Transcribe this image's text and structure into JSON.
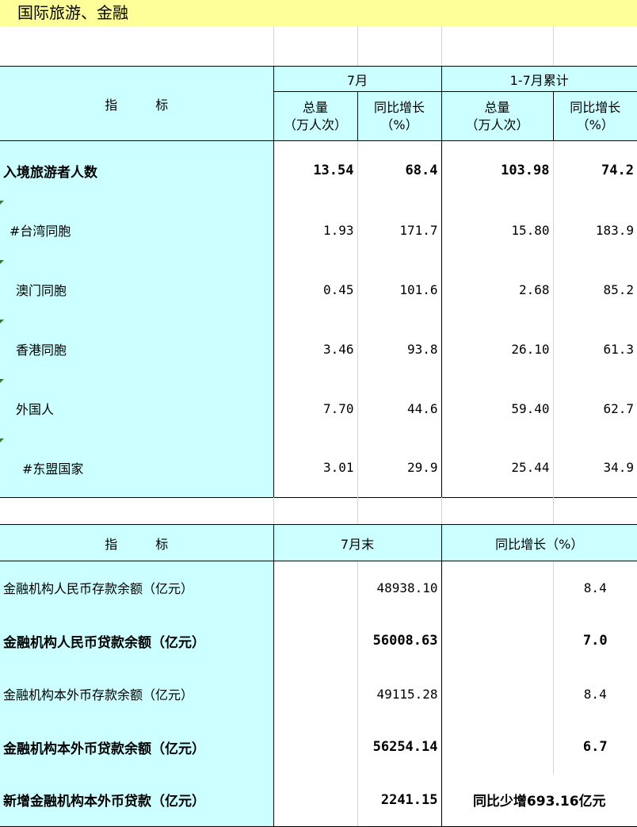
{
  "title": "国际旅游、金融",
  "tourism": {
    "header": {
      "indicator": "指　　　标",
      "group1": "7月",
      "group2": "1-7月累计",
      "total_line1": "总量",
      "total_line2": "（万人次）",
      "growth_line1": "同比增长",
      "growth_line2": "（%）"
    },
    "rows": [
      {
        "label": "入境旅游者人数",
        "v1": "13.54",
        "v2": "68.4",
        "v3": "103.98",
        "v4": "74.2"
      },
      {
        "label": "#台湾同胞",
        "v1": "1.93",
        "v2": "171.7",
        "v3": "15.80",
        "v4": "183.9"
      },
      {
        "label": "澳门同胞",
        "v1": "0.45",
        "v2": "101.6",
        "v3": "2.68",
        "v4": "85.2"
      },
      {
        "label": "香港同胞",
        "v1": "3.46",
        "v2": "93.8",
        "v3": "26.10",
        "v4": "61.3"
      },
      {
        "label": "外国人",
        "v1": "7.70",
        "v2": "44.6",
        "v3": "59.40",
        "v4": "62.7"
      },
      {
        "label": "#东盟国家",
        "v1": "3.01",
        "v2": "29.9",
        "v3": "25.44",
        "v4": "34.9"
      }
    ]
  },
  "finance": {
    "header": {
      "indicator": "指　　　标",
      "month_end": "7月末",
      "growth": "同比增长（%）"
    },
    "rows": [
      {
        "label": "金融机构人民币存款余额（亿元）",
        "value": "48938.10",
        "growth": "8.4"
      },
      {
        "label": "金融机构人民币贷款余额（亿元）",
        "value": "56008.63",
        "growth": "7.0"
      },
      {
        "label": "金融机构本外币存款余额（亿元）",
        "value": "49115.28",
        "growth": "8.4"
      },
      {
        "label": "金融机构本外币贷款余额（亿元）",
        "value": "56254.14",
        "growth": "6.7"
      },
      {
        "label": "新增金融机构本外币贷款（亿元）",
        "value": "2241.15",
        "growth_note": "同比少增693.16亿元"
      }
    ]
  }
}
